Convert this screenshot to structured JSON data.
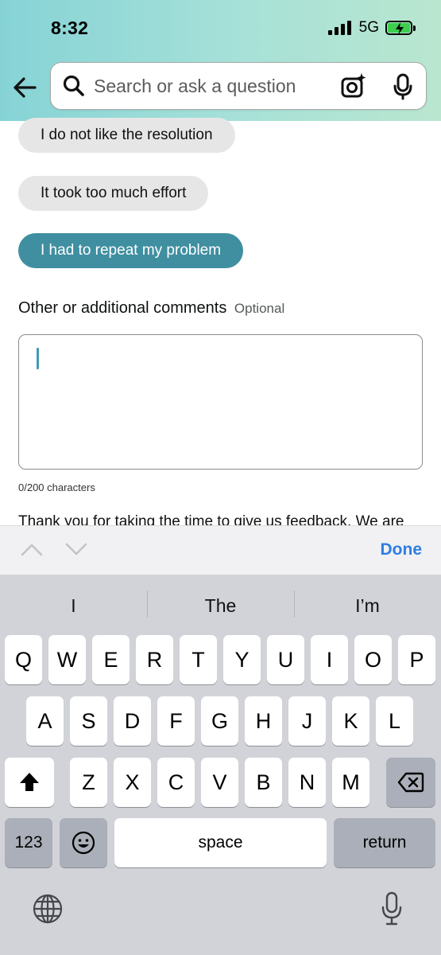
{
  "status_bar": {
    "time": "8:32",
    "network": "5G"
  },
  "search": {
    "placeholder": "Search or ask a question"
  },
  "feedback": {
    "options": [
      {
        "label": "I do not like the resolution",
        "selected": false
      },
      {
        "label": "It took too much effort",
        "selected": false
      },
      {
        "label": "I had to repeat my problem",
        "selected": true
      }
    ],
    "comments_label": "Other or additional comments",
    "optional_label": "Optional",
    "comments_value": "",
    "char_count": "0/200 characters",
    "thank_you": "Thank you for taking the time to give us feedback. We are"
  },
  "accessory": {
    "done_label": "Done"
  },
  "keyboard": {
    "predictions": [
      "I",
      "The",
      "I’m"
    ],
    "row1": [
      "Q",
      "W",
      "E",
      "R",
      "T",
      "Y",
      "U",
      "I",
      "O",
      "P"
    ],
    "row2": [
      "A",
      "S",
      "D",
      "F",
      "G",
      "H",
      "J",
      "K",
      "L"
    ],
    "row3": [
      "Z",
      "X",
      "C",
      "V",
      "B",
      "N",
      "M"
    ],
    "numbers_label": "123",
    "space_label": "space",
    "return_label": "return"
  },
  "colors": {
    "selected_chip": "#3f8fa0",
    "done": "#2f7de1",
    "caret": "#3f9bb2"
  }
}
